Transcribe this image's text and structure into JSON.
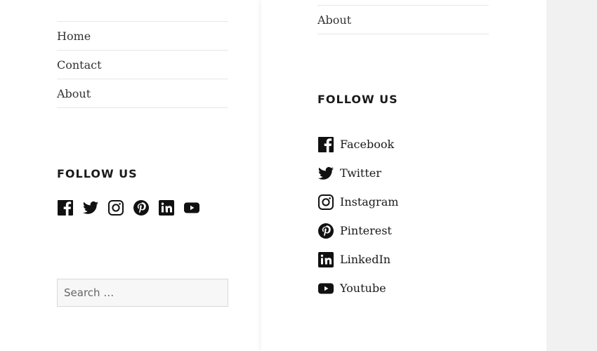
{
  "left_widget": {
    "menu": [
      "Home",
      "Contact",
      "About"
    ],
    "follow_heading": "FOLLOW US",
    "search_placeholder": "Search …"
  },
  "right_widget": {
    "menu": [
      "About"
    ],
    "follow_heading": "FOLLOW US",
    "social_links": [
      {
        "label": "Facebook",
        "icon": "facebook-icon"
      },
      {
        "label": "Twitter",
        "icon": "twitter-icon"
      },
      {
        "label": "Instagram",
        "icon": "instagram-icon"
      },
      {
        "label": "Pinterest",
        "icon": "pinterest-icon"
      },
      {
        "label": "LinkedIn",
        "icon": "linkedin-icon"
      },
      {
        "label": "Youtube",
        "icon": "youtube-icon"
      }
    ]
  }
}
